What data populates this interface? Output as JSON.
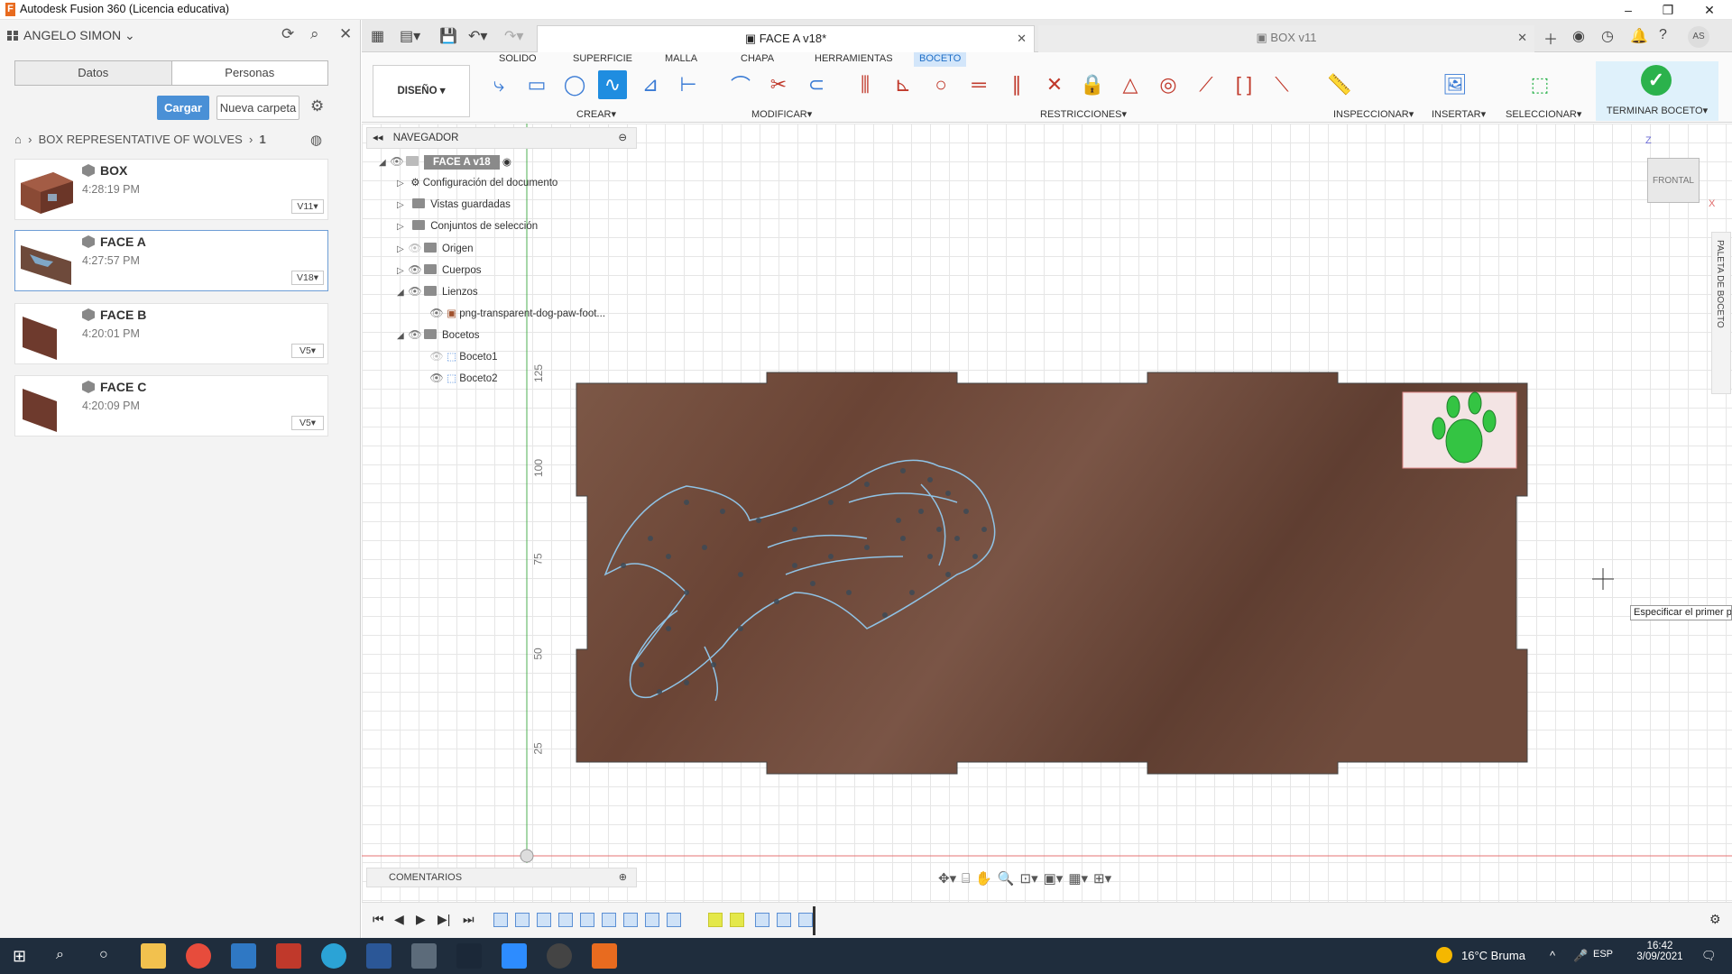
{
  "window": {
    "title": "Autodesk Fusion 360 (Licencia educativa)"
  },
  "data_panel": {
    "user": "ANGELO SIMON",
    "tabs": [
      "Datos",
      "Personas"
    ],
    "upload_label": "Cargar",
    "new_folder_label": "Nueva carpeta",
    "breadcrumb": [
      "BOX REPRESENTATIVE OF WOLVES",
      "1"
    ],
    "files": [
      {
        "name": "BOX",
        "time": "4:28:19 PM",
        "version": "V11"
      },
      {
        "name": "FACE A",
        "time": "4:27:57 PM",
        "version": "V18"
      },
      {
        "name": "FACE B",
        "time": "4:20:01 PM",
        "version": "V5"
      },
      {
        "name": "FACE C",
        "time": "4:20:09 PM",
        "version": "V5"
      }
    ]
  },
  "doc_tabs": [
    {
      "label": "FACE A v18*",
      "active": true
    },
    {
      "label": "BOX v11",
      "active": false
    }
  ],
  "toolbar": {
    "workspace_tabs": [
      "SOLIDO",
      "SUPERFICIE",
      "MALLA",
      "CHAPA",
      "HERRAMIENTAS",
      "BOCETO"
    ],
    "active_tab": "BOCETO",
    "design": "DISEÑO",
    "groups": {
      "create": "CREAR",
      "modify": "MODIFICAR",
      "constraints": "RESTRICCIONES",
      "inspect": "INSPECCIONAR",
      "insert": "INSERTAR",
      "select": "SELECCIONAR",
      "finish": "TERMINAR BOCETO"
    }
  },
  "navigator": {
    "title": "NAVEGADOR",
    "root": "FACE A v18",
    "items": [
      {
        "label": "Configuración del documento",
        "icon": "gear-icon",
        "indent": 0
      },
      {
        "label": "Vistas guardadas",
        "icon": "folder-icon",
        "indent": 0
      },
      {
        "label": "Conjuntos de selección",
        "icon": "folder-icon",
        "indent": 0
      },
      {
        "label": "Origen",
        "icon": "folder-icon",
        "indent": 0
      },
      {
        "label": "Cuerpos",
        "icon": "folder-icon",
        "indent": 0
      },
      {
        "label": "Lienzos",
        "icon": "folder-icon",
        "indent": 0
      },
      {
        "label": "png-transparent-dog-paw-foot...",
        "icon": "image-icon",
        "indent": 1
      },
      {
        "label": "Bocetos",
        "icon": "folder-icon",
        "indent": 0
      },
      {
        "label": "Boceto1",
        "icon": "sketch-icon",
        "indent": 1
      },
      {
        "label": "Boceto2",
        "icon": "sketch-icon",
        "indent": 1
      }
    ]
  },
  "canvas": {
    "ruler_labels": [
      "125",
      "100",
      "75",
      "50",
      "25"
    ],
    "viewcube_label": "FRONTAL",
    "axis_z": "Z",
    "axis_x": "X",
    "tooltip": "Especificar el primer pu",
    "side_palette": "PALETA DE BOCETO"
  },
  "comments": {
    "label": "COMENTARIOS"
  },
  "taskbar": {
    "weather": "16°C Bruma",
    "lang": "ESP",
    "time": "16:42",
    "date": "3/09/2021"
  },
  "colors": {
    "accent": "#1f8de0",
    "finish_green": "#2bb24c",
    "wood": "#6e4a3b"
  }
}
